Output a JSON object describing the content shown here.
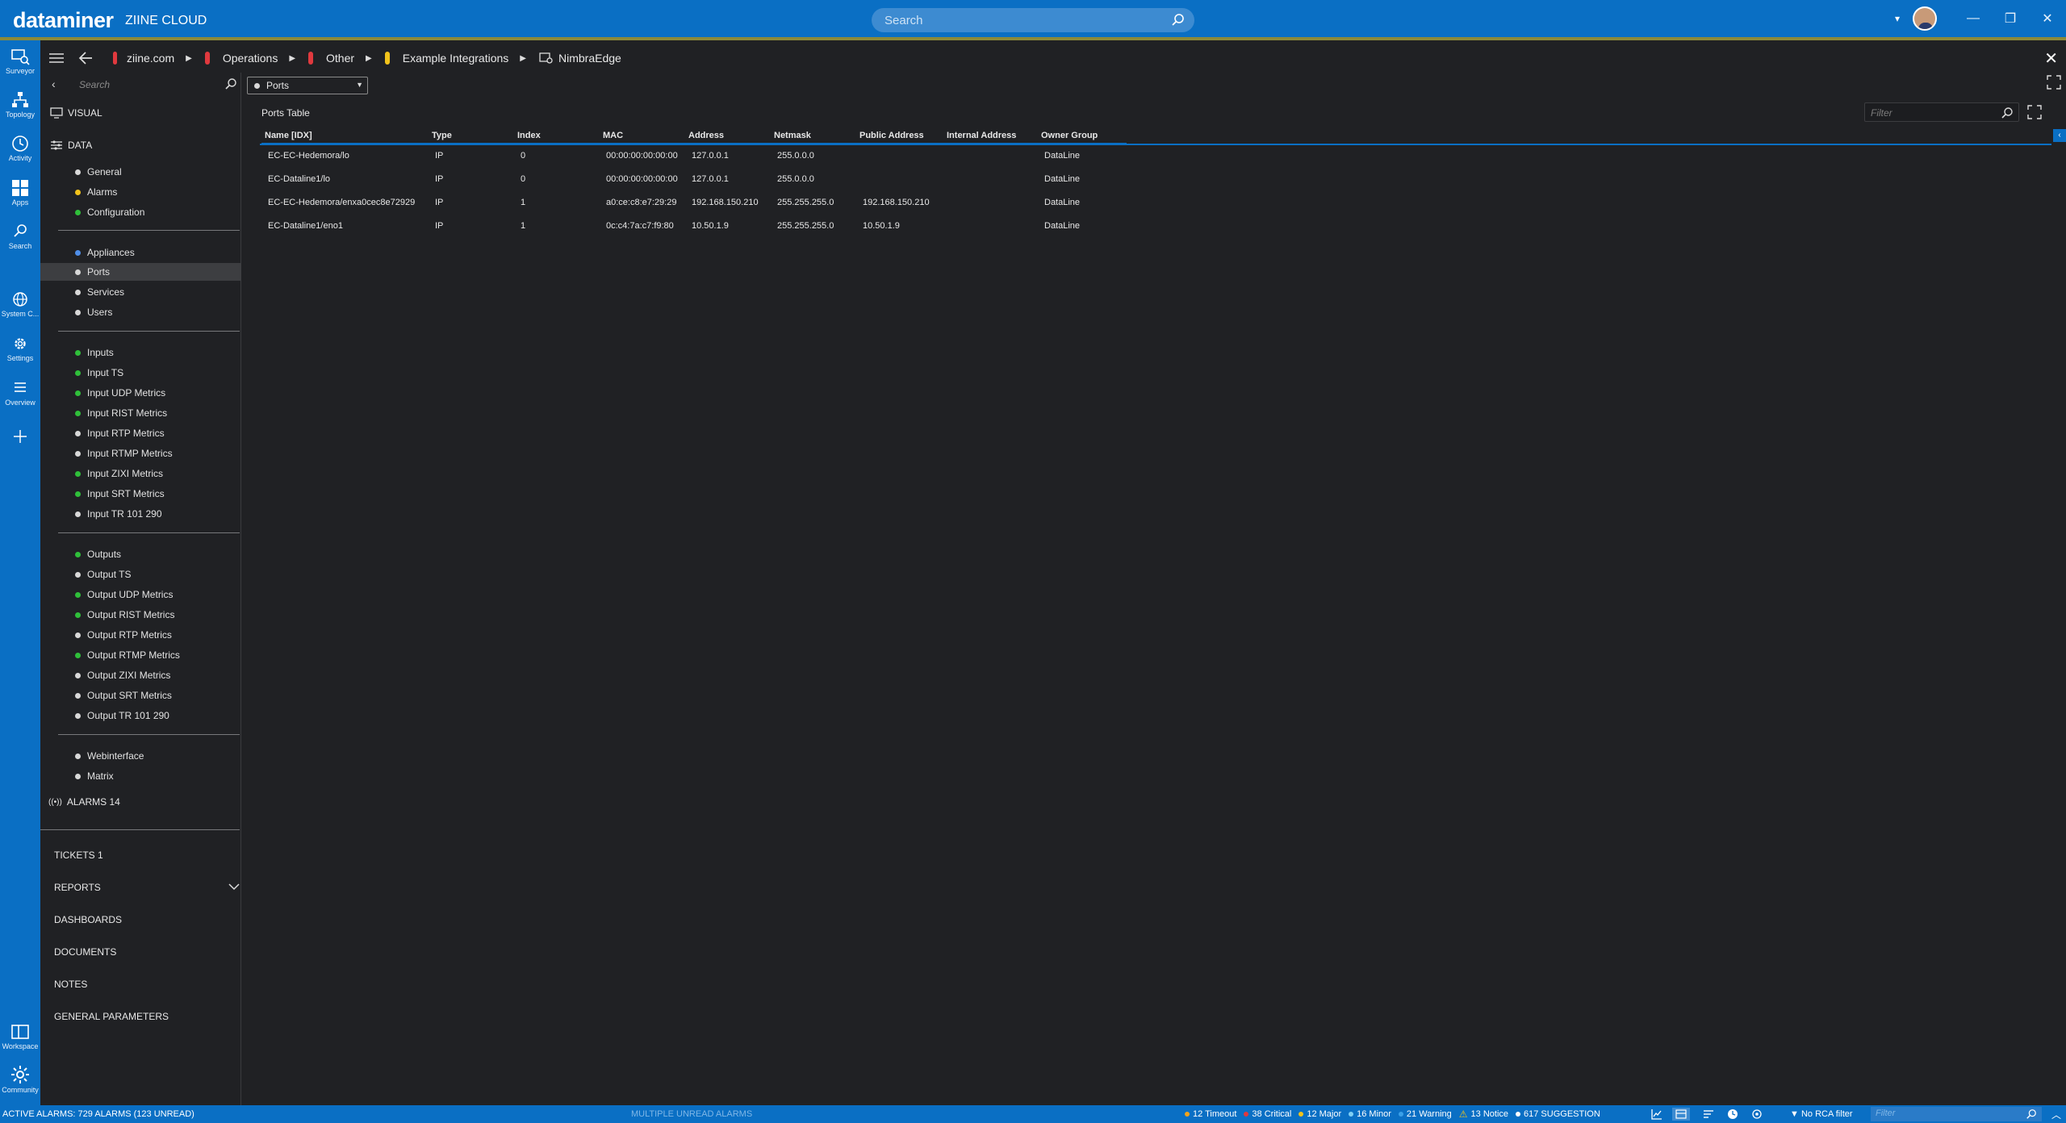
{
  "app": {
    "brand": "dataminer",
    "brand_sub": "ZIINE CLOUD",
    "search_placeholder": "Search"
  },
  "rail": [
    {
      "label": "Surveyor",
      "icon": "surveyor-icon"
    },
    {
      "label": "Topology",
      "icon": "topology-icon"
    },
    {
      "label": "Activity",
      "icon": "activity-icon"
    },
    {
      "label": "Apps",
      "icon": "apps-icon"
    },
    {
      "label": "Search",
      "icon": "search-icon"
    },
    {
      "label": "System C...",
      "icon": "globe-icon"
    },
    {
      "label": "Settings",
      "icon": "gear-icon"
    },
    {
      "label": "Overview",
      "icon": "list-icon"
    },
    {
      "label": "Workspace",
      "icon": "workspace-icon"
    },
    {
      "label": "Community",
      "icon": "community-icon"
    }
  ],
  "breadcrumbs": [
    {
      "label": "ziine.com",
      "color": "#e0393e"
    },
    {
      "label": "Operations",
      "color": "#e0393e"
    },
    {
      "label": "Other",
      "color": "#e0393e"
    },
    {
      "label": "Example Integrations",
      "color": "#f2c31b"
    },
    {
      "label": "NimbraEdge",
      "color": ""
    }
  ],
  "sidepanel": {
    "search_placeholder": "Search",
    "visual_label": "VISUAL",
    "data_label": "DATA",
    "groups": [
      [
        {
          "label": "General",
          "color": "#d8d8d8"
        },
        {
          "label": "Alarms",
          "color": "#f2c31b"
        },
        {
          "label": "Configuration",
          "color": "#2fbf3a"
        }
      ],
      [
        {
          "label": "Appliances",
          "color": "#4f8ee8"
        },
        {
          "label": "Ports",
          "color": "#d8d8d8",
          "active": true
        },
        {
          "label": "Services",
          "color": "#d8d8d8"
        },
        {
          "label": "Users",
          "color": "#d8d8d8"
        }
      ],
      [
        {
          "label": "Inputs",
          "color": "#2fbf3a"
        },
        {
          "label": "Input TS",
          "color": "#2fbf3a"
        },
        {
          "label": "Input UDP Metrics",
          "color": "#2fbf3a"
        },
        {
          "label": "Input RIST Metrics",
          "color": "#2fbf3a"
        },
        {
          "label": "Input RTP Metrics",
          "color": "#d8d8d8"
        },
        {
          "label": "Input RTMP Metrics",
          "color": "#d8d8d8"
        },
        {
          "label": "Input ZIXI Metrics",
          "color": "#2fbf3a"
        },
        {
          "label": "Input SRT Metrics",
          "color": "#2fbf3a"
        },
        {
          "label": "Input TR 101 290",
          "color": "#d8d8d8"
        }
      ],
      [
        {
          "label": "Outputs",
          "color": "#2fbf3a"
        },
        {
          "label": "Output TS",
          "color": "#d8d8d8"
        },
        {
          "label": "Output UDP Metrics",
          "color": "#2fbf3a"
        },
        {
          "label": "Output RIST Metrics",
          "color": "#2fbf3a"
        },
        {
          "label": "Output RTP Metrics",
          "color": "#d8d8d8"
        },
        {
          "label": "Output RTMP Metrics",
          "color": "#2fbf3a"
        },
        {
          "label": "Output ZIXI Metrics",
          "color": "#d8d8d8"
        },
        {
          "label": "Output SRT Metrics",
          "color": "#d8d8d8"
        },
        {
          "label": "Output TR 101 290",
          "color": "#d8d8d8"
        }
      ],
      [
        {
          "label": "Webinterface",
          "color": "#d8d8d8"
        },
        {
          "label": "Matrix",
          "color": "#d8d8d8"
        }
      ]
    ],
    "alarms_label": "ALARMS 14",
    "bottom": [
      "TICKETS 1",
      "REPORTS",
      "DASHBOARDS",
      "DOCUMENTS",
      "NOTES",
      "GENERAL PARAMETERS"
    ]
  },
  "main": {
    "table_select": "Ports",
    "table_title": "Ports Table",
    "filter_placeholder": "Filter",
    "columns": [
      "Name [IDX]",
      "Type",
      "Index",
      "MAC",
      "Address",
      "Netmask",
      "Public Address",
      "Internal Address",
      "Owner Group"
    ],
    "rows": [
      [
        "EC-EC-Hedemora/lo",
        "IP",
        "0",
        "00:00:00:00:00:00",
        "127.0.0.1",
        "255.0.0.0",
        "",
        "",
        "DataLine"
      ],
      [
        "EC-Dataline1/lo",
        "IP",
        "0",
        "00:00:00:00:00:00",
        "127.0.0.1",
        "255.0.0.0",
        "",
        "",
        "DataLine"
      ],
      [
        "EC-EC-Hedemora/enxa0cec8e72929",
        "IP",
        "1",
        "a0:ce:c8:e7:29:29",
        "192.168.150.210",
        "255.255.255.0",
        "192.168.150.210",
        "",
        "DataLine"
      ],
      [
        "EC-Dataline1/eno1",
        "IP",
        "1",
        "0c:c4:7a:c7:f9:80",
        "10.50.1.9",
        "255.255.255.0",
        "10.50.1.9",
        "",
        "DataLine"
      ]
    ]
  },
  "statusbar": {
    "active_alarms": "ACTIVE ALARMS: 729 ALARMS (123 UNREAD)",
    "middle": "MULTIPLE UNREAD ALARMS",
    "counts": [
      {
        "label": "12 Timeout",
        "color": "#f2a31b"
      },
      {
        "label": "38 Critical",
        "color": "#e0393e"
      },
      {
        "label": "12 Major",
        "color": "#f2c31b"
      },
      {
        "label": "16 Minor",
        "color": "#7fd0f5"
      },
      {
        "label": "21 Warning",
        "color": "#3aa0e8"
      },
      {
        "label": "13 Notice",
        "color": "#f2c31b",
        "triangle": true
      },
      {
        "label": "617 SUGGESTION",
        "color": "#ffffff"
      }
    ],
    "rca_label": "No RCA filter",
    "filter_placeholder": "Filter"
  }
}
